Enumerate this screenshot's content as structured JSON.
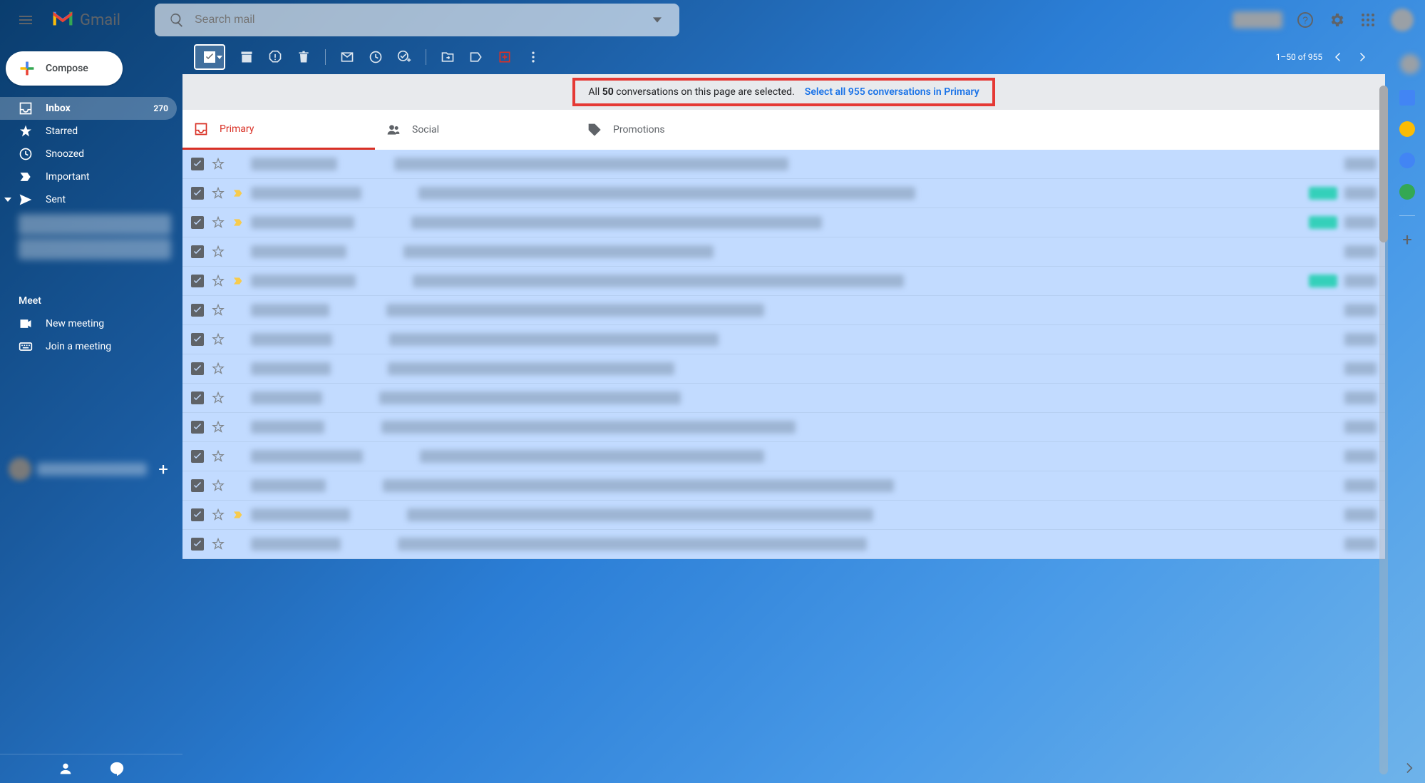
{
  "header": {
    "search_placeholder": "Search mail",
    "brand": "Gmail"
  },
  "sidebar": {
    "compose": "Compose",
    "items": [
      {
        "label": "Inbox",
        "count": "270"
      },
      {
        "label": "Starred"
      },
      {
        "label": "Snoozed"
      },
      {
        "label": "Important"
      },
      {
        "label": "Sent"
      }
    ],
    "meet": {
      "title": "Meet",
      "new": "New meeting",
      "join": "Join a meeting"
    }
  },
  "toolbar": {
    "pager": "1–50 of 955"
  },
  "banner": {
    "text_prefix": "All ",
    "count": "50",
    "text_suffix": " conversations on this page are selected.",
    "link": "Select all 955 conversations in Primary"
  },
  "tabs": {
    "primary": "Primary",
    "social": "Social",
    "promotions": "Promotions"
  },
  "mail_rows": 14
}
